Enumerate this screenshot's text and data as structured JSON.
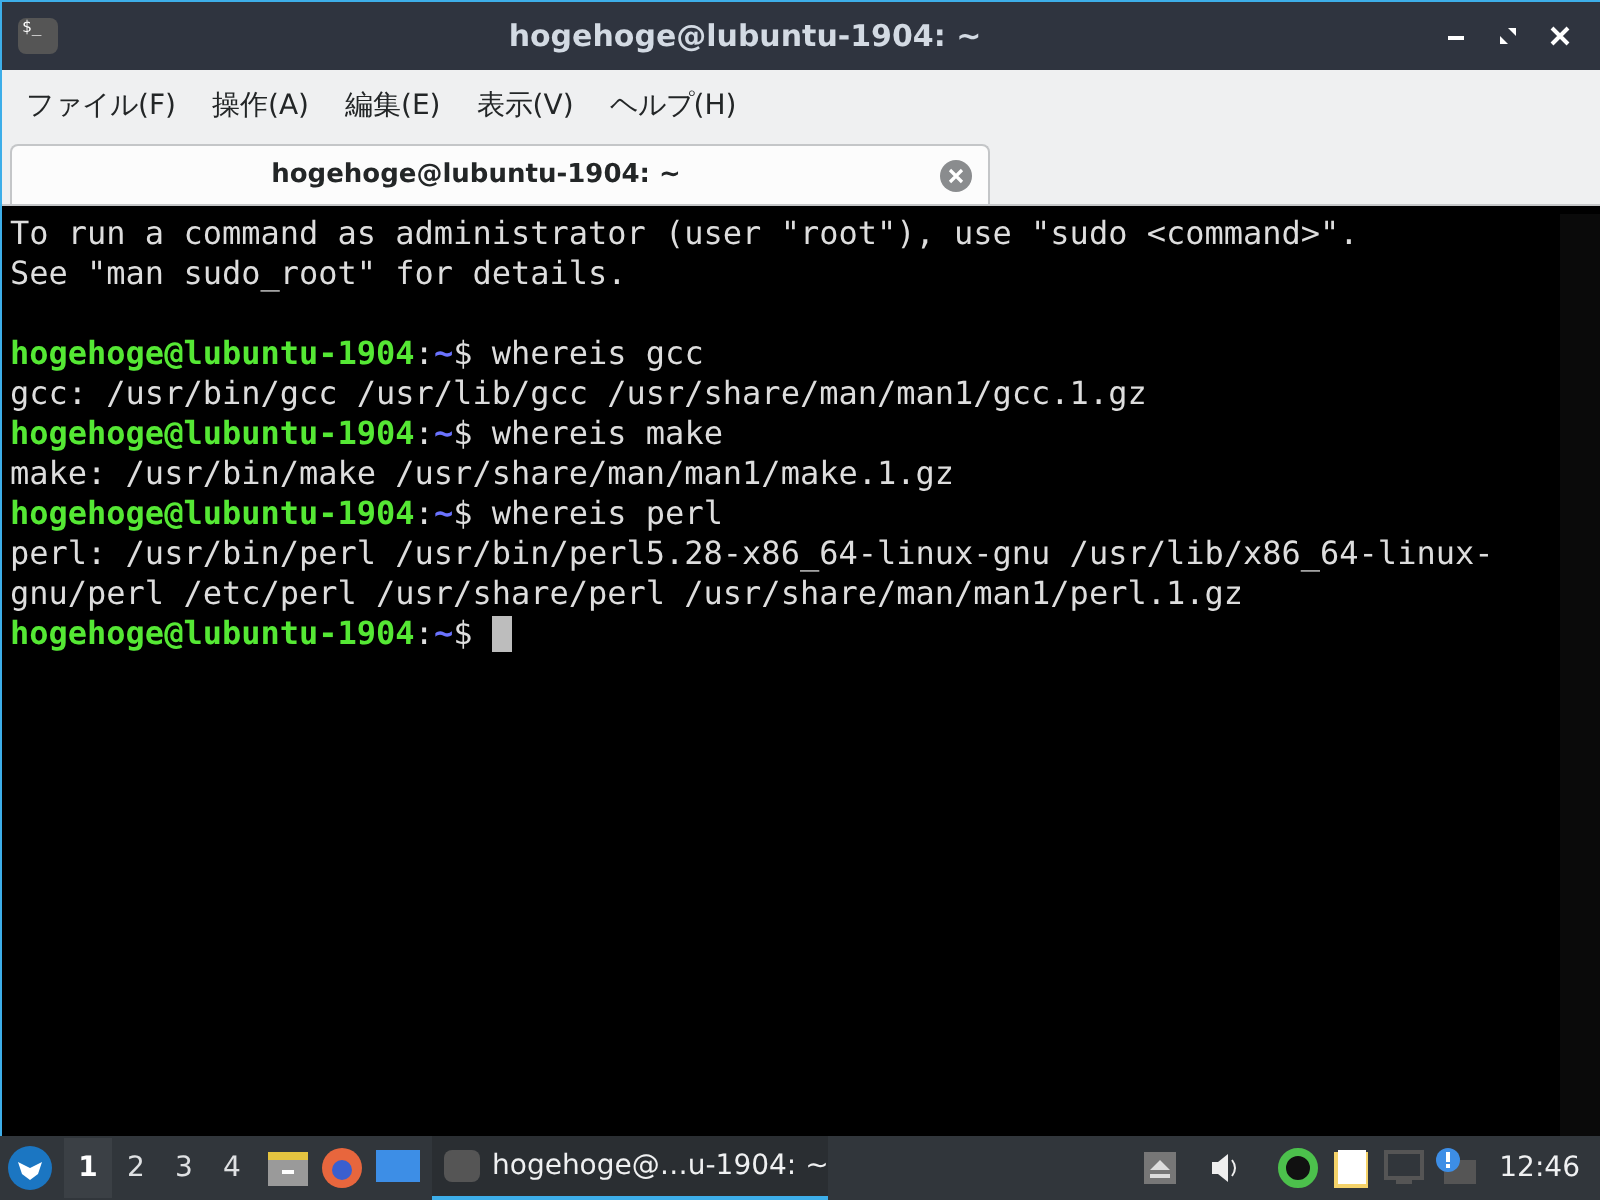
{
  "window": {
    "icon_text": "$_",
    "title": "hogehoge@lubuntu-1904: ~"
  },
  "menu": [
    "ファイル(F)",
    "操作(A)",
    "編集(E)",
    "表示(V)",
    "ヘルプ(H)"
  ],
  "tabs": [
    {
      "label": "hogehoge@lubuntu-1904: ~",
      "selected": true
    }
  ],
  "terminal": [
    {
      "kind": "output",
      "text": "To run a command as administrator (user \"root\"), use \"sudo <command>\"."
    },
    {
      "kind": "output",
      "text": "See \"man sudo_root\" for details."
    },
    {
      "kind": "blank"
    },
    {
      "kind": "prompt",
      "user": "hogehoge@lubuntu-1904",
      "colon": ":",
      "path": "~",
      "sign": "$",
      "command": "whereis gcc"
    },
    {
      "kind": "output",
      "text": "gcc: /usr/bin/gcc /usr/lib/gcc /usr/share/man/man1/gcc.1.gz"
    },
    {
      "kind": "prompt",
      "user": "hogehoge@lubuntu-1904",
      "colon": ":",
      "path": "~",
      "sign": "$",
      "command": "whereis make"
    },
    {
      "kind": "output",
      "text": "make: /usr/bin/make /usr/share/man/man1/make.1.gz"
    },
    {
      "kind": "prompt",
      "user": "hogehoge@lubuntu-1904",
      "colon": ":",
      "path": "~",
      "sign": "$",
      "command": "whereis perl"
    },
    {
      "kind": "output",
      "text": "perl: /usr/bin/perl /usr/bin/perl5.28-x86_64-linux-gnu /usr/lib/x86_64-linux-"
    },
    {
      "kind": "output",
      "text": "gnu/perl /etc/perl /usr/share/perl /usr/share/man/man1/perl.1.gz"
    },
    {
      "kind": "prompt",
      "user": "hogehoge@lubuntu-1904",
      "colon": ":",
      "path": "~",
      "sign": "$",
      "cursor": true
    }
  ],
  "taskbar": {
    "desktops": [
      {
        "label": "1",
        "selected": true
      },
      {
        "label": "2",
        "selected": false
      },
      {
        "label": "3",
        "selected": false
      },
      {
        "label": "4",
        "selected": false
      }
    ],
    "tasks": [
      {
        "label": "hogehoge@…u-1904: ~",
        "selected": true
      }
    ],
    "clock": "12:46"
  }
}
